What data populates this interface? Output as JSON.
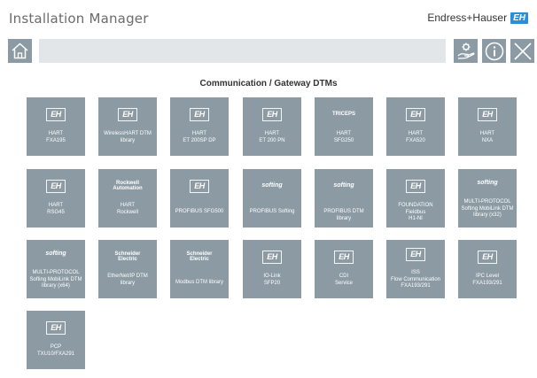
{
  "app": {
    "title": "Installation Manager",
    "brand_text": "Endress+Hauser",
    "brand_logo": "EH"
  },
  "toolbar": {
    "home_icon": "home-icon",
    "settings_icon": "settings-hand-icon",
    "info_icon": "info-icon",
    "close_icon": "close-icon"
  },
  "section": {
    "title": "Communication / Gateway DTMs"
  },
  "colors": {
    "tile": "#8b9aa3",
    "accent": "#2a8fd8",
    "search_bg": "#e2e6e8"
  },
  "tiles": [
    {
      "logo": "EH",
      "label": "HART\nFXA195"
    },
    {
      "logo": "EH",
      "label": "WirelessHART DTM\nlibrary"
    },
    {
      "logo": "EH",
      "label": "HART\nET 200SP DP"
    },
    {
      "logo": "EH",
      "label": "HART\nET 200 PN"
    },
    {
      "logo": "TRICEPS",
      "label": "HART\nSFG250"
    },
    {
      "logo": "EH",
      "label": "HART\nFXA520"
    },
    {
      "logo": "EH",
      "label": "HART\nNXA"
    },
    {
      "logo": "EH",
      "label": "HART\nRSG45"
    },
    {
      "logo": "Rockwell\nAutomation",
      "label": "HART\nRockwell"
    },
    {
      "logo": "EH",
      "label": "PROFIBUS SFG500"
    },
    {
      "logo": "softing",
      "label": "PROFIBUS Softing"
    },
    {
      "logo": "softing",
      "label": "PROFIBUS DTM library"
    },
    {
      "logo": "EH",
      "label": "FOUNDATION Fieldbus\nH1-NI"
    },
    {
      "logo": "softing",
      "label": "MULTI-PROTOCOL\nSofting MobiLink DTM\nlibrary (x32)"
    },
    {
      "logo": "softing",
      "label": "MULTI-PROTOCOL\nSofting MobiLink DTM\nlibrary (x64)"
    },
    {
      "logo": "Schneider\nElectric",
      "label": "EtherNet/IP DTM\nlibrary"
    },
    {
      "logo": "Schneider\nElectric",
      "label": "Modbus DTM library"
    },
    {
      "logo": "EH",
      "label": "IO-Link\nSFP20"
    },
    {
      "logo": "EH",
      "label": "CDI\nService"
    },
    {
      "logo": "EH",
      "label": "ISS\nFlow Communication\nFXA193/291"
    },
    {
      "logo": "EH",
      "label": "IPC Level\nFXA193/291"
    },
    {
      "logo": "EH",
      "label": "PCP\nTXU10/FXA291"
    }
  ]
}
